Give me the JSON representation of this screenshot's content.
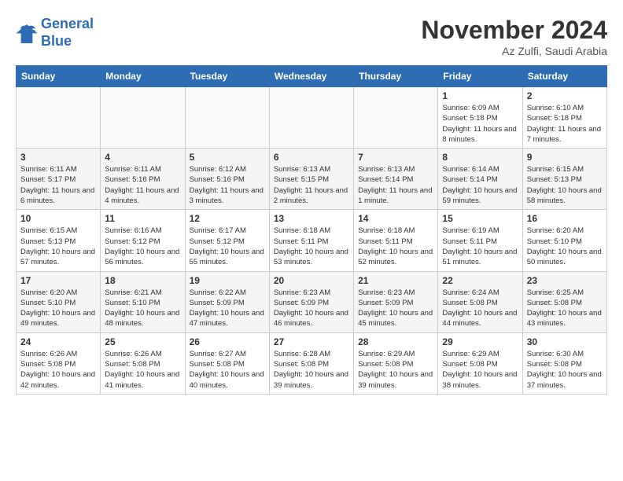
{
  "logo": {
    "line1": "General",
    "line2": "Blue"
  },
  "header": {
    "month": "November 2024",
    "location": "Az Zulfi, Saudi Arabia"
  },
  "weekdays": [
    "Sunday",
    "Monday",
    "Tuesday",
    "Wednesday",
    "Thursday",
    "Friday",
    "Saturday"
  ],
  "weeks": [
    [
      {
        "day": "",
        "sunrise": "",
        "sunset": "",
        "daylight": ""
      },
      {
        "day": "",
        "sunrise": "",
        "sunset": "",
        "daylight": ""
      },
      {
        "day": "",
        "sunrise": "",
        "sunset": "",
        "daylight": ""
      },
      {
        "day": "",
        "sunrise": "",
        "sunset": "",
        "daylight": ""
      },
      {
        "day": "",
        "sunrise": "",
        "sunset": "",
        "daylight": ""
      },
      {
        "day": "1",
        "sunrise": "Sunrise: 6:09 AM",
        "sunset": "Sunset: 5:18 PM",
        "daylight": "Daylight: 11 hours and 8 minutes."
      },
      {
        "day": "2",
        "sunrise": "Sunrise: 6:10 AM",
        "sunset": "Sunset: 5:18 PM",
        "daylight": "Daylight: 11 hours and 7 minutes."
      }
    ],
    [
      {
        "day": "3",
        "sunrise": "Sunrise: 6:11 AM",
        "sunset": "Sunset: 5:17 PM",
        "daylight": "Daylight: 11 hours and 6 minutes."
      },
      {
        "day": "4",
        "sunrise": "Sunrise: 6:11 AM",
        "sunset": "Sunset: 5:16 PM",
        "daylight": "Daylight: 11 hours and 4 minutes."
      },
      {
        "day": "5",
        "sunrise": "Sunrise: 6:12 AM",
        "sunset": "Sunset: 5:16 PM",
        "daylight": "Daylight: 11 hours and 3 minutes."
      },
      {
        "day": "6",
        "sunrise": "Sunrise: 6:13 AM",
        "sunset": "Sunset: 5:15 PM",
        "daylight": "Daylight: 11 hours and 2 minutes."
      },
      {
        "day": "7",
        "sunrise": "Sunrise: 6:13 AM",
        "sunset": "Sunset: 5:14 PM",
        "daylight": "Daylight: 11 hours and 1 minute."
      },
      {
        "day": "8",
        "sunrise": "Sunrise: 6:14 AM",
        "sunset": "Sunset: 5:14 PM",
        "daylight": "Daylight: 10 hours and 59 minutes."
      },
      {
        "day": "9",
        "sunrise": "Sunrise: 6:15 AM",
        "sunset": "Sunset: 5:13 PM",
        "daylight": "Daylight: 10 hours and 58 minutes."
      }
    ],
    [
      {
        "day": "10",
        "sunrise": "Sunrise: 6:15 AM",
        "sunset": "Sunset: 5:13 PM",
        "daylight": "Daylight: 10 hours and 57 minutes."
      },
      {
        "day": "11",
        "sunrise": "Sunrise: 6:16 AM",
        "sunset": "Sunset: 5:12 PM",
        "daylight": "Daylight: 10 hours and 56 minutes."
      },
      {
        "day": "12",
        "sunrise": "Sunrise: 6:17 AM",
        "sunset": "Sunset: 5:12 PM",
        "daylight": "Daylight: 10 hours and 55 minutes."
      },
      {
        "day": "13",
        "sunrise": "Sunrise: 6:18 AM",
        "sunset": "Sunset: 5:11 PM",
        "daylight": "Daylight: 10 hours and 53 minutes."
      },
      {
        "day": "14",
        "sunrise": "Sunrise: 6:18 AM",
        "sunset": "Sunset: 5:11 PM",
        "daylight": "Daylight: 10 hours and 52 minutes."
      },
      {
        "day": "15",
        "sunrise": "Sunrise: 6:19 AM",
        "sunset": "Sunset: 5:11 PM",
        "daylight": "Daylight: 10 hours and 51 minutes."
      },
      {
        "day": "16",
        "sunrise": "Sunrise: 6:20 AM",
        "sunset": "Sunset: 5:10 PM",
        "daylight": "Daylight: 10 hours and 50 minutes."
      }
    ],
    [
      {
        "day": "17",
        "sunrise": "Sunrise: 6:20 AM",
        "sunset": "Sunset: 5:10 PM",
        "daylight": "Daylight: 10 hours and 49 minutes."
      },
      {
        "day": "18",
        "sunrise": "Sunrise: 6:21 AM",
        "sunset": "Sunset: 5:10 PM",
        "daylight": "Daylight: 10 hours and 48 minutes."
      },
      {
        "day": "19",
        "sunrise": "Sunrise: 6:22 AM",
        "sunset": "Sunset: 5:09 PM",
        "daylight": "Daylight: 10 hours and 47 minutes."
      },
      {
        "day": "20",
        "sunrise": "Sunrise: 6:23 AM",
        "sunset": "Sunset: 5:09 PM",
        "daylight": "Daylight: 10 hours and 46 minutes."
      },
      {
        "day": "21",
        "sunrise": "Sunrise: 6:23 AM",
        "sunset": "Sunset: 5:09 PM",
        "daylight": "Daylight: 10 hours and 45 minutes."
      },
      {
        "day": "22",
        "sunrise": "Sunrise: 6:24 AM",
        "sunset": "Sunset: 5:08 PM",
        "daylight": "Daylight: 10 hours and 44 minutes."
      },
      {
        "day": "23",
        "sunrise": "Sunrise: 6:25 AM",
        "sunset": "Sunset: 5:08 PM",
        "daylight": "Daylight: 10 hours and 43 minutes."
      }
    ],
    [
      {
        "day": "24",
        "sunrise": "Sunrise: 6:26 AM",
        "sunset": "Sunset: 5:08 PM",
        "daylight": "Daylight: 10 hours and 42 minutes."
      },
      {
        "day": "25",
        "sunrise": "Sunrise: 6:26 AM",
        "sunset": "Sunset: 5:08 PM",
        "daylight": "Daylight: 10 hours and 41 minutes."
      },
      {
        "day": "26",
        "sunrise": "Sunrise: 6:27 AM",
        "sunset": "Sunset: 5:08 PM",
        "daylight": "Daylight: 10 hours and 40 minutes."
      },
      {
        "day": "27",
        "sunrise": "Sunrise: 6:28 AM",
        "sunset": "Sunset: 5:08 PM",
        "daylight": "Daylight: 10 hours and 39 minutes."
      },
      {
        "day": "28",
        "sunrise": "Sunrise: 6:29 AM",
        "sunset": "Sunset: 5:08 PM",
        "daylight": "Daylight: 10 hours and 39 minutes."
      },
      {
        "day": "29",
        "sunrise": "Sunrise: 6:29 AM",
        "sunset": "Sunset: 5:08 PM",
        "daylight": "Daylight: 10 hours and 38 minutes."
      },
      {
        "day": "30",
        "sunrise": "Sunrise: 6:30 AM",
        "sunset": "Sunset: 5:08 PM",
        "daylight": "Daylight: 10 hours and 37 minutes."
      }
    ]
  ]
}
